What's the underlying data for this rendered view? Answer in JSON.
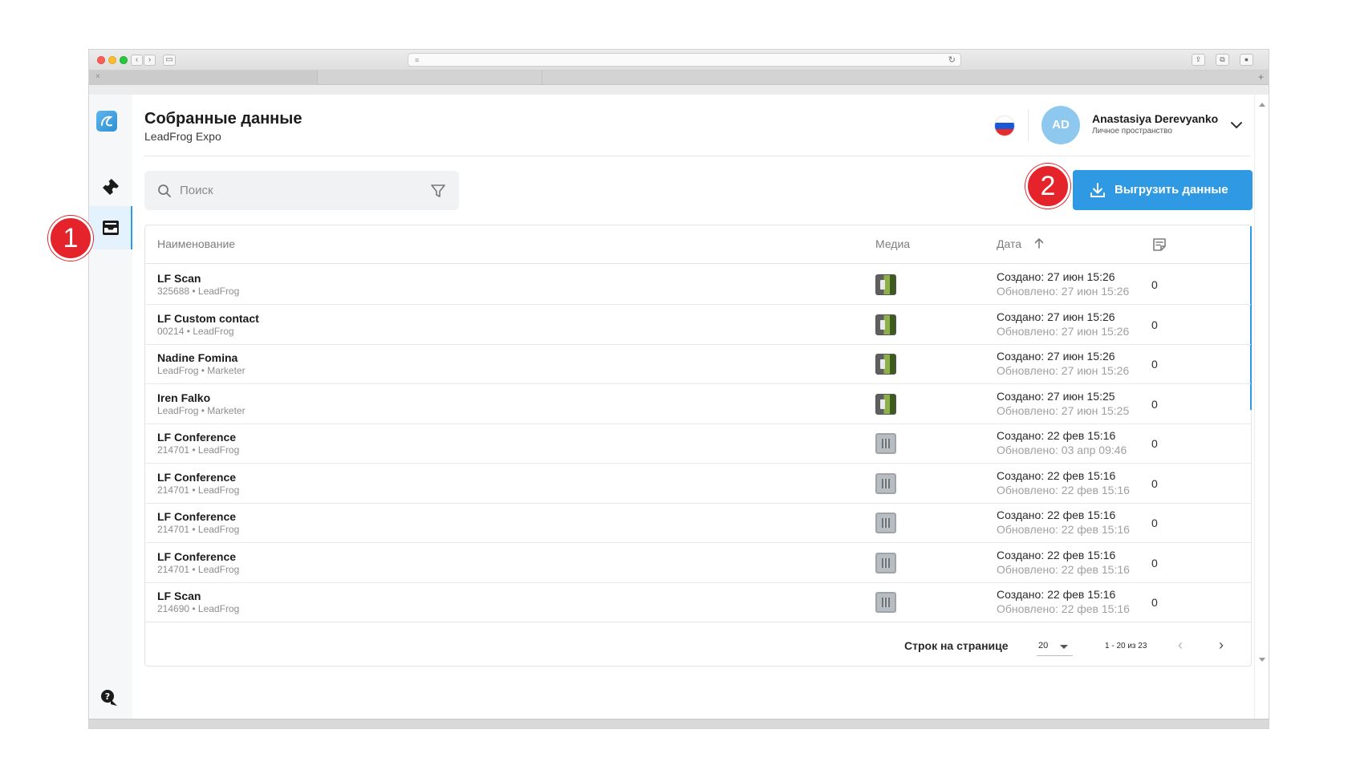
{
  "browser": {
    "tab_close": "×",
    "tab_plus": "+"
  },
  "header": {
    "title": "Собранные данные",
    "subtitle": "LeadFrog Expo",
    "avatar_initials": "AD",
    "user_name": "Anastasiya Derevyanko",
    "user_space": "Личное пространство"
  },
  "toolbar": {
    "search_placeholder": "Поиск",
    "export_label": "Выгрузить данные"
  },
  "markers": [
    "1",
    "2"
  ],
  "table": {
    "columns": {
      "name": "Наименование",
      "media": "Медиа",
      "date": "Дата"
    },
    "rows": [
      {
        "title": "LF Scan",
        "sub": "325688 • LeadFrog",
        "media": "photo",
        "created": "Создано: 27 июн 15:26",
        "updated": "Обновлено: 27 июн 15:26",
        "count": "0"
      },
      {
        "title": "LF Custom contact",
        "sub": "00214 • LeadFrog",
        "media": "photo",
        "created": "Создано: 27 июн 15:26",
        "updated": "Обновлено: 27 июн 15:26",
        "count": "0"
      },
      {
        "title": "Nadine Fomina",
        "sub": "LeadFrog • Marketer",
        "media": "photo",
        "created": "Создано: 27 июн 15:26",
        "updated": "Обновлено: 27 июн 15:26",
        "count": "0"
      },
      {
        "title": "Iren Falko",
        "sub": "LeadFrog • Marketer",
        "media": "photo",
        "created": "Создано: 27 июн 15:25",
        "updated": "Обновлено: 27 июн 15:25",
        "count": "0"
      },
      {
        "title": "LF Conference",
        "sub": "214701 • LeadFrog",
        "media": "badge",
        "created": "Создано: 22 фев 15:16",
        "updated": "Обновлено: 03 апр 09:46",
        "count": "0"
      },
      {
        "title": "LF Conference",
        "sub": "214701 • LeadFrog",
        "media": "badge",
        "created": "Создано: 22 фев 15:16",
        "updated": "Обновлено: 22 фев 15:16",
        "count": "0"
      },
      {
        "title": "LF Conference",
        "sub": "214701 • LeadFrog",
        "media": "badge",
        "created": "Создано: 22 фев 15:16",
        "updated": "Обновлено: 22 фев 15:16",
        "count": "0"
      },
      {
        "title": "LF Conference",
        "sub": "214701 • LeadFrog",
        "media": "badge",
        "created": "Создано: 22 фев 15:16",
        "updated": "Обновлено: 22 фев 15:16",
        "count": "0"
      },
      {
        "title": "LF Scan",
        "sub": "214690 • LeadFrog",
        "media": "badge",
        "created": "Создано: 22 фев 15:16",
        "updated": "Обновлено: 22 фев 15:16",
        "count": "0"
      }
    ]
  },
  "pagination": {
    "rows_label": "Строк на странице",
    "rows_per_page": "20",
    "range": "1 - 20 из 23",
    "prev": "‹",
    "next": "›"
  },
  "colors": {
    "accent": "#2f9ae3",
    "marker": "#e4242a",
    "avatar": "#8ec8ee"
  },
  "icons": [
    "logo-icon",
    "ticket-icon",
    "inbox-icon",
    "help-chat-icon",
    "search-icon",
    "filter-icon",
    "download-icon",
    "sort-arrow-up-icon",
    "note-icon",
    "chevron-down-icon",
    "russia-flag-icon"
  ]
}
